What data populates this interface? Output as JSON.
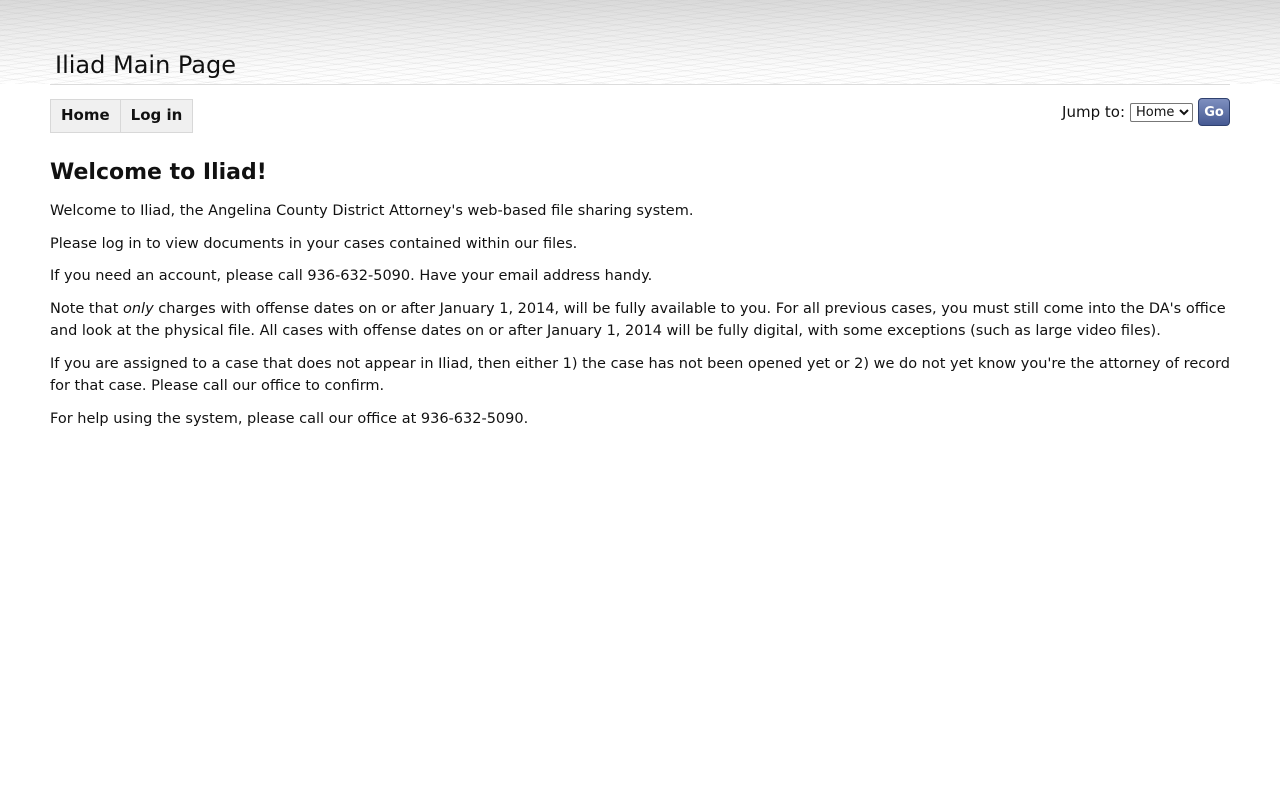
{
  "header": {
    "site_title": "Iliad Main Page"
  },
  "nav": {
    "items": [
      {
        "label": "Home"
      },
      {
        "label": "Log in"
      }
    ]
  },
  "jump_to": {
    "label": "Jump to:",
    "selected": "Home",
    "go_label": "Go"
  },
  "main": {
    "heading": "Welcome to Iliad!",
    "p1": "Welcome to Iliad, the Angelina County District Attorney's web-based file sharing system.",
    "p2": "Please log in to view documents in your cases contained within our files.",
    "p3": "If you need an account, please call 936-632-5090. Have your email address handy.",
    "p4_prefix": "Note that ",
    "p4_emphasis": "only",
    "p4_rest": " charges with offense dates on or after January 1, 2014, will be fully available to you. For all previous cases, you must still come into the DA's office and look at the physical file. All cases with offense dates on or after January 1, 2014 will be fully digital, with some exceptions (such as large video files).",
    "p5": "If you are assigned to a case that does not appear in Iliad, then either 1) the case has not been opened yet or 2) we do not yet know you're the attorney of record for that case. Please call our office to confirm.",
    "p6": "For help using the system, please call our office at 936-632-5090."
  }
}
